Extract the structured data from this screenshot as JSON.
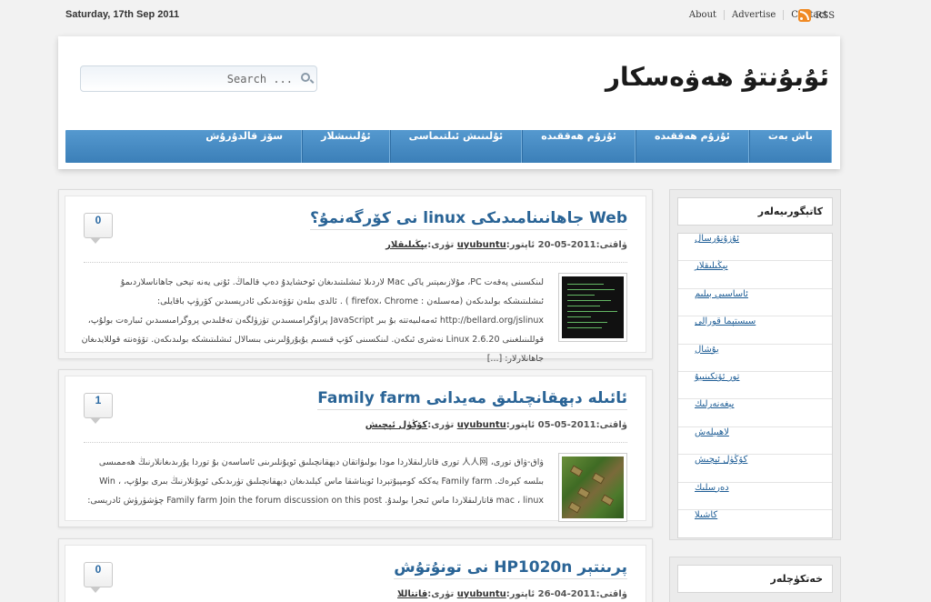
{
  "topbar": {
    "date": "Saturday, 17th Sep 2011",
    "links": [
      "About",
      "Advertise",
      "Contact"
    ],
    "rss_label": "RSS",
    "rss_icon": "rss-icon"
  },
  "header": {
    "site_title": "ئۇبۇنتۇ ھەۋەسكار",
    "search_placeholder": "Search ...",
    "search_icon": "search-icon"
  },
  "nav": {
    "items": [
      "باش بەت",
      "ئۇزۇم ھەققىدە",
      "ئۇزۇم ھەققىدە",
      "ئۇلىنىش ئىلتىماسى",
      "ئۇلىنىشلار",
      "سۆز قالدۇرۇش"
    ]
  },
  "posts": [
    {
      "comments": "0",
      "title": "Web جاھانىنامىدىكى linux نى كۆرگەنمۇ؟",
      "meta_date": "ۋاقتى:2011-05-20",
      "meta_author_label": "ئاپتور:",
      "meta_author": "uyubuntu",
      "meta_cat_label": "تۈرى:",
      "meta_cat": "يېڭىلىقلار",
      "excerpt": "لىنكسىنى پەقەت PC، مۇلازىمېتىر ياكى Mac لاردىلا ئىشلىتىدىغان ئوخشايدۇ دەپ قالماڭ. ئۇنى يەنە تېخى جاھاناسلاردىمۇ ئىشلىتىشكە بولىدىكەن (مەسىلەن : firefox، Chrome ) . ئالدى بىلەن تۆۋەندىكى ئادرېسىدىن كۆرۈپ باقايلى: http://bellard.org/jslinux ئەمەلىيەتتە بۇ بىر JavaScript پراۋگرامىسىدىن تۈزۈلگەن تەقلىدىي پروگرامىسىدىن ئىبارەت بولۇپ، قوللىنىلغىنى Linux 2.6.20 نەشرى ئىكەن. لىنكسىنى كۆپ قىسىم يۇيۇرۇلىرىنى بىسالال ئىشلىتىشكە بولىدىكەن. تۆۋەنتە قوللايدىغان جاھانلارلار: [...]"
    },
    {
      "comments": "1",
      "title": "ئائىلە دېھقانچىلىق مەيدانى Family farm",
      "meta_date": "ۋاقتى:2011-05-05",
      "meta_author_label": "ئاپتور:",
      "meta_author": "uyubuntu",
      "meta_cat_label": "تۈرى:",
      "meta_cat": "كۆڭۈل ئېچىش",
      "excerpt": "ۋاق-ۋاق تورى، 人人网 تورى قاتارلىقلاردا مودا بولىۋاتقان دېھقانچىلىق ئويۇنلىرىنى ئاساسەن بۇ توردا يۇرىدىغانلارنىڭ ھەممىسى بىلسە كېرەك. Family farm يەككە كومپيۇتېردا ئويناشقا ماس كېلىدىغان دېھقانچىلىق تۈرىدىكى ئويۇنلارنىڭ بىرى بولۇپ، Win ، mac ، linux قاتارلىقلاردا ماس ئىجرا بولىدۇ. Family farm Join the forum discussion on this post چۈشۈرۈش ئادرېسى:"
    },
    {
      "comments": "0",
      "title": "پرىنتېر HP1020n نى تونۇتۇش",
      "meta_date": "ۋاقتى:2011-04-26",
      "meta_author_label": "ئاپتور:",
      "meta_author": "uyubuntu",
      "meta_cat_label": "تۈرى:",
      "meta_cat": "قاتتاللا"
    }
  ],
  "sidebar": {
    "categories_title": "كاتېگورىيەلەر",
    "categories": [
      "ئۇزۇنۇرساﻝ",
      "يېڭىلىقلار",
      "ئاساسىي بىلىم",
      "سىستېما قورالى",
      "يۇشال",
      "تور ئۆتكىنىيۇ",
      "يېغەنەرلىك",
      "لاھىيلەش",
      "كۆڭۈل ئېچىش",
      "دەرسلىك",
      "كاشىلا"
    ],
    "bookmarks_title": "خەتكۈچلەر"
  }
}
